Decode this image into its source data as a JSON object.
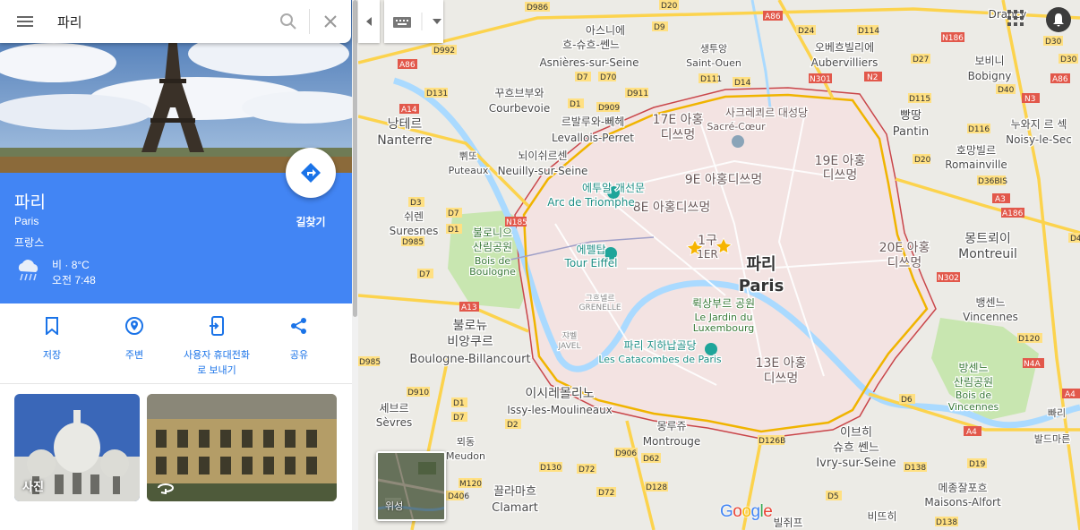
{
  "search": {
    "value": "파리",
    "placeholder": ""
  },
  "place": {
    "title": "파리",
    "subtitle": "Paris",
    "country": "프랑스",
    "weather_summary": "비 · 8°C",
    "weather_time": "오전 7:48",
    "weather_icon": "rain-cloud-icon",
    "directions_label": "길찾기"
  },
  "actions": [
    {
      "label": "저장",
      "icon": "bookmark-icon"
    },
    {
      "label": "주변",
      "icon": "nearby-pin-icon"
    },
    {
      "label": "사용자 휴대전화\n로 보내기",
      "label_line1": "사용자 휴대전화",
      "label_line2": "로 보내기",
      "icon": "send-to-phone-icon"
    },
    {
      "label": "공유",
      "icon": "share-icon"
    }
  ],
  "photos": [
    {
      "label": "사진"
    },
    {
      "label": ""
    }
  ],
  "map": {
    "satellite_label": "위성",
    "logo": "Google",
    "center_label_ko": "파리",
    "center_label_en": "Paris",
    "labels": [
      {
        "ko": "아스니에",
        "en": ""
      },
      {
        "ko": "흐-슈흐-쎈느",
        "en": "Asnières-sur-Seine"
      },
      {
        "ko": "생투앙",
        "en": "Saint-Ouen"
      },
      {
        "ko": "오베흐빌리에",
        "en": "Aubervilliers"
      },
      {
        "ko": "보비니",
        "en": "Bobigny"
      },
      {
        "ko": "꾸흐브부와",
        "en": "Courbevoie"
      },
      {
        "ko": "르발루와-뻬헤",
        "en": "Levallois-Perret"
      },
      {
        "ko": "낭테르",
        "en": "Nanterre"
      },
      {
        "ko": "뇌이쉬르센",
        "en": "Neuilly-sur-Seine"
      },
      {
        "ko": "쀠또",
        "en": "Puteaux"
      },
      {
        "ko": "쉬렌",
        "en": "Suresnes"
      },
      {
        "ko": "불로니으",
        "en": ""
      },
      {
        "ko": "산림공원",
        "en": ""
      },
      {
        "ko": "Bois de",
        "en": "Boulogne"
      },
      {
        "ko": "불로뉴",
        "en": ""
      },
      {
        "ko": "비앙쿠르",
        "en": "Boulogne-Billancourt"
      },
      {
        "ko": "세브르",
        "en": "Sèvres"
      },
      {
        "ko": "뫼동",
        "en": "Meudon"
      },
      {
        "ko": "이시레몰리노",
        "en": "Issy-les-Moulineaux"
      },
      {
        "ko": "몽루쥬",
        "en": "Montrouge"
      },
      {
        "ko": "끌라마흐",
        "en": "Clamart"
      },
      {
        "ko": "빌쥐프",
        "en": ""
      },
      {
        "ko": "이브히",
        "en": ""
      },
      {
        "ko": "슈흐 쎈느",
        "en": "Ivry-sur-Seine"
      },
      {
        "ko": "비뜨히",
        "en": ""
      },
      {
        "ko": "메종잘포흐",
        "en": "Maisons-Alfort"
      },
      {
        "ko": "뱅센느",
        "en": "Vincennes"
      },
      {
        "ko": "방센느",
        "en": ""
      },
      {
        "ko": "산림공원",
        "en": ""
      },
      {
        "ko": "Bois de",
        "en": "Vincennes"
      },
      {
        "ko": "몽트뢰이",
        "en": "Montreuil"
      },
      {
        "ko": "호망빌르",
        "en": "Romainville"
      },
      {
        "ko": "빵땅",
        "en": "Pantin"
      },
      {
        "ko": "누와지 르 섹",
        "en": "Noisy-le-Sec"
      },
      {
        "ko": "드랑시",
        "en": "Drancy"
      },
      {
        "ko": "17E 아홍",
        "en": "디쓰멍"
      },
      {
        "ko": "사크레쾨르 대성당",
        "en": "Sacré-Cœur"
      },
      {
        "ko": "19E 아홍",
        "en": "디쓰멍"
      },
      {
        "ko": "9E 아홍디쓰멍",
        "en": ""
      },
      {
        "ko": "8E 아홍디쓰멍",
        "en": ""
      },
      {
        "ko": "에투알 개선문",
        "en": "Arc de Triomphe"
      },
      {
        "ko": "에펠탑",
        "en": "Tour Eiffel"
      },
      {
        "ko": "1구",
        "en": "1ER"
      },
      {
        "ko": "20E 아홍",
        "en": "디쓰멍"
      },
      {
        "ko": "뤽상부르 공원",
        "en": "Le Jardin du"
      },
      {
        "ko": "Luxembourg",
        "en": ""
      },
      {
        "ko": "그흐넬르",
        "en": "GRENELLE"
      },
      {
        "ko": "쟈벨",
        "en": "JAVEL"
      },
      {
        "ko": "파리 지하납골당",
        "en": "Les Catacombes de Paris"
      },
      {
        "ko": "13E 아홍",
        "en": "디쓰멍"
      },
      {
        "ko": "빠리",
        "en": ""
      },
      {
        "ko": "발드마른",
        "en": ""
      }
    ]
  },
  "colors": {
    "accent": "#4285f4",
    "link": "#1a73e8",
    "paris_fill": "#f3e3e2",
    "paris_border": "#c9464a",
    "road_major": "#fcd34d",
    "park": "#c8e6b0",
    "water": "#aadaff"
  }
}
